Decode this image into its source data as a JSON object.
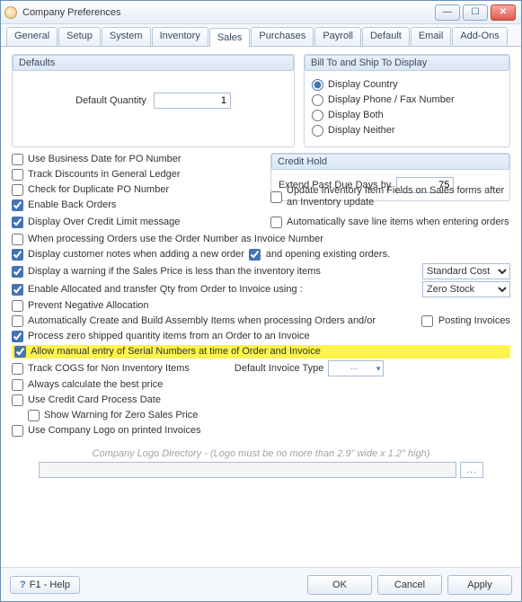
{
  "window": {
    "title": "Company Preferences"
  },
  "tabs": [
    "General",
    "Setup",
    "System",
    "Inventory",
    "Sales",
    "Purchases",
    "Payroll",
    "Default",
    "Email",
    "Add-Ons"
  ],
  "active_tab": "Sales",
  "defaults": {
    "header": "Defaults",
    "default_quantity_label": "Default Quantity",
    "default_quantity_value": "1"
  },
  "billship": {
    "header": "Bill To and Ship To Display",
    "options": {
      "country": "Display Country",
      "phone": "Display Phone / Fax Number",
      "both": "Display Both",
      "neither": "Display Neither"
    },
    "selected": "country"
  },
  "credit_hold": {
    "header": "Credit Hold",
    "label": "Extend Past Due Days by",
    "value": "75"
  },
  "checks": {
    "use_business_date": "Use Business Date for PO Number",
    "track_discounts": "Track Discounts in General Ledger",
    "check_dup_po": "Check for Duplicate PO Number",
    "enable_back_orders": "Enable Back Orders",
    "display_over_credit": "Display Over Credit Limit message",
    "update_inv_fields": "Update Inventory Item Fields on Sales forms after an Inventory update",
    "auto_save_lines": "Automatically save line items when entering orders",
    "use_order_as_invoice": "When processing Orders use the Order Number as Invoice Number",
    "display_cust_notes": "Display customer notes when adding a new order",
    "and_opening": "and opening existing orders.",
    "warn_less_inventory": "Display a warning if the Sales Price is less than the inventory items",
    "enable_allocated": "Enable Allocated and transfer Qty from Order to Invoice using :",
    "prevent_neg_alloc": "Prevent Negative Allocation",
    "auto_build_assembly": "Automatically Create and Build Assembly Items when processing Orders and/or",
    "posting_invoices": "Posting Invoices",
    "process_zero_shipped": "Process zero shipped quantity items from an Order to an Invoice",
    "allow_manual_serial": "Allow manual entry of Serial Numbers at time of Order and Invoice",
    "track_cogs": "Track COGS for Non Inventory Items",
    "default_invoice_type": "Default Invoice Type",
    "always_best_price": "Always calculate the best price",
    "use_cc_process_date": "Use Credit Card Process Date",
    "warn_zero_price": "Show Warning for Zero Sales Price",
    "use_company_logo": "Use Company Logo on printed Invoices"
  },
  "selects": {
    "cost_basis": {
      "value": "Standard Cost",
      "options": [
        "Standard Cost"
      ]
    },
    "zero_stock": {
      "value": "Zero Stock",
      "options": [
        "Zero Stock"
      ]
    }
  },
  "logo": {
    "note": "Company Logo Directory - (Logo must be no more than 2.9\" wide x 1.2\" high)",
    "path": ""
  },
  "footer": {
    "help": "F1 - Help",
    "ok": "OK",
    "cancel": "Cancel",
    "apply": "Apply"
  }
}
